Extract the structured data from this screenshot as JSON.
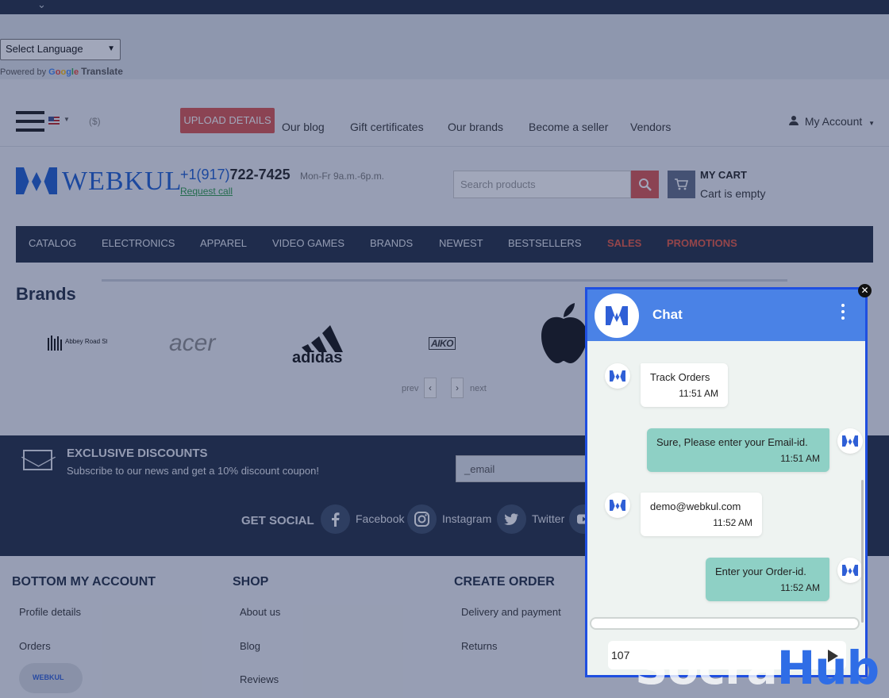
{
  "translate": {
    "select_label": "Select Language",
    "powered_by": "Powered by",
    "google": "Google",
    "translate": "Translate"
  },
  "header": {
    "currency": "($)",
    "upload_button": "UPLOAD DETAILS",
    "nav": [
      "Our blog",
      "Gift certificates",
      "Our brands",
      "Become a seller",
      "Vendors"
    ],
    "account": "My Account"
  },
  "logo": {
    "text": "WEBKUL"
  },
  "contact": {
    "phone_prefix": "+1(917)",
    "phone_number": "722-7425",
    "hours": "Mon-Fr 9a.m.-6p.m.",
    "request_call": "Request call"
  },
  "search": {
    "placeholder": "Search products"
  },
  "cart": {
    "title": "MY CART",
    "status": "Cart is empty"
  },
  "categories": {
    "items": [
      "CATALOG",
      "ELECTRONICS",
      "APPAREL",
      "VIDEO GAMES",
      "BRANDS",
      "NEWEST",
      "BESTSELLERS"
    ],
    "hot": [
      "SALES",
      "PROMOTIONS"
    ]
  },
  "brands": {
    "title": "Brands",
    "logos": [
      "Abbey Road Studios",
      "acer",
      "adidas",
      "AIKO"
    ],
    "prev": "prev",
    "next": "next"
  },
  "subscribe": {
    "title": "EXCLUSIVE DISCOUNTS",
    "text": "Subscribe to our news and get a 10% discount coupon!",
    "email_placeholder": "_email"
  },
  "social": {
    "title": "GET SOCIAL",
    "items": [
      "Facebook",
      "Instagram",
      "Twitter"
    ]
  },
  "footer": {
    "col1_title": "BOTTOM MY ACCOUNT",
    "col1_links": [
      "Profile details",
      "Orders"
    ],
    "col2_title": "SHOP",
    "col2_links": [
      "About us",
      "Blog",
      "Reviews"
    ],
    "col3_title": "CREATE ORDER",
    "col3_links": [
      "Delivery and payment",
      "Returns"
    ]
  },
  "chat": {
    "title": "Chat",
    "messages": [
      {
        "text": "Track Orders",
        "time": "11:51 AM",
        "dir": "in"
      },
      {
        "text": "Sure, Please enter your Email-id.",
        "time": "11:51 AM",
        "dir": "out"
      },
      {
        "text": "demo@webkul.com",
        "time": "11:52 AM",
        "dir": "in"
      },
      {
        "text": "Enter your Order-id.",
        "time": "11:52 AM",
        "dir": "out"
      }
    ],
    "input_value": "107"
  },
  "watermark": {
    "part1": "Socra",
    "part2": "Hub"
  },
  "colors": {
    "navy": "#1f2c42",
    "accent_red": "#d9534f",
    "brand_blue": "#1a5ccf",
    "chat_header": "#4a82e6",
    "bubble_out": "#8ed0c5"
  }
}
